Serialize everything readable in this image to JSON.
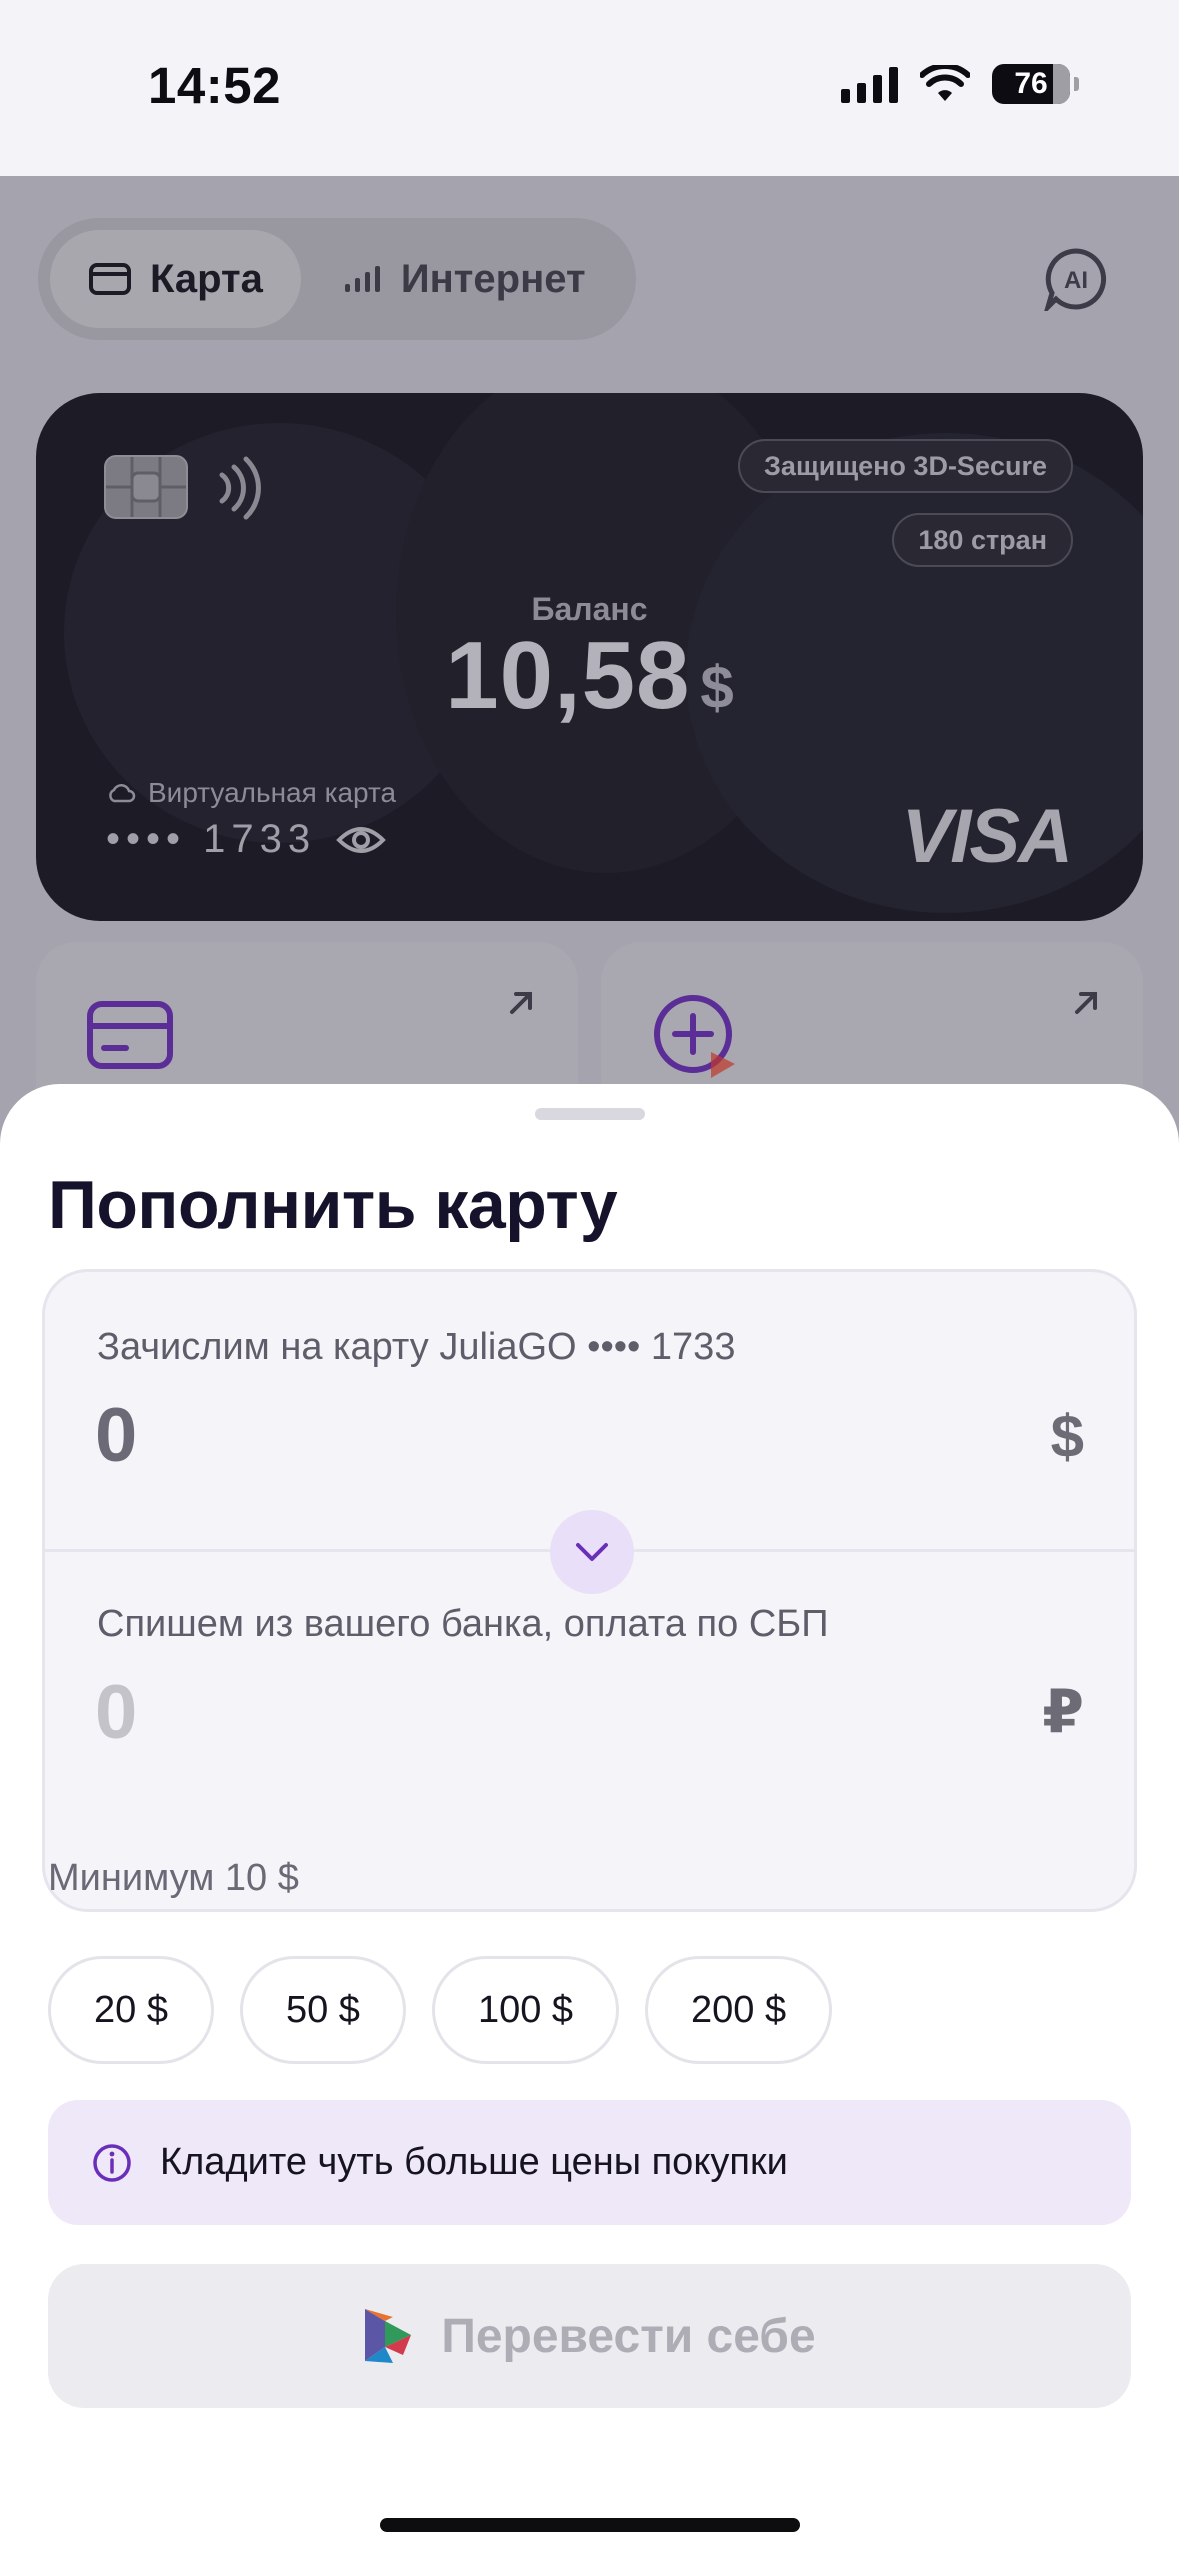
{
  "status_bar": {
    "time": "14:52",
    "battery": "76"
  },
  "background": {
    "tabs": [
      {
        "label": "Карта",
        "icon": "card-icon",
        "active": true
      },
      {
        "label": "Интернет",
        "icon": "signal-bars-icon",
        "active": false
      }
    ],
    "ai_button": "AI",
    "card": {
      "badges": [
        "Защищено 3D-Secure",
        "180 стран"
      ],
      "balance_label": "Баланс",
      "balance_value": "10,58",
      "balance_currency": "$",
      "type_label": "Виртуальная карта",
      "number_masked": "•••• 1733",
      "brand": "VISA"
    }
  },
  "sheet": {
    "title": "Пополнить карту",
    "credit": {
      "label": "Зачислим на карту JuliaGO •••• 1733",
      "value": "0",
      "currency": "$"
    },
    "debit": {
      "label": "Спишем из вашего банка, оплата по СБП",
      "value": "0",
      "currency": "₽"
    },
    "minimum": "Минимум 10 $",
    "quick_amounts": [
      "20 $",
      "50 $",
      "100 $",
      "200 $"
    ],
    "hint": "Кладите чуть больше цены покупки",
    "submit_label": "Перевести себе"
  },
  "colors": {
    "accent": "#6a2fb8",
    "hint_bg": "#efe8f8",
    "disabled_button": "#ecebf0"
  }
}
